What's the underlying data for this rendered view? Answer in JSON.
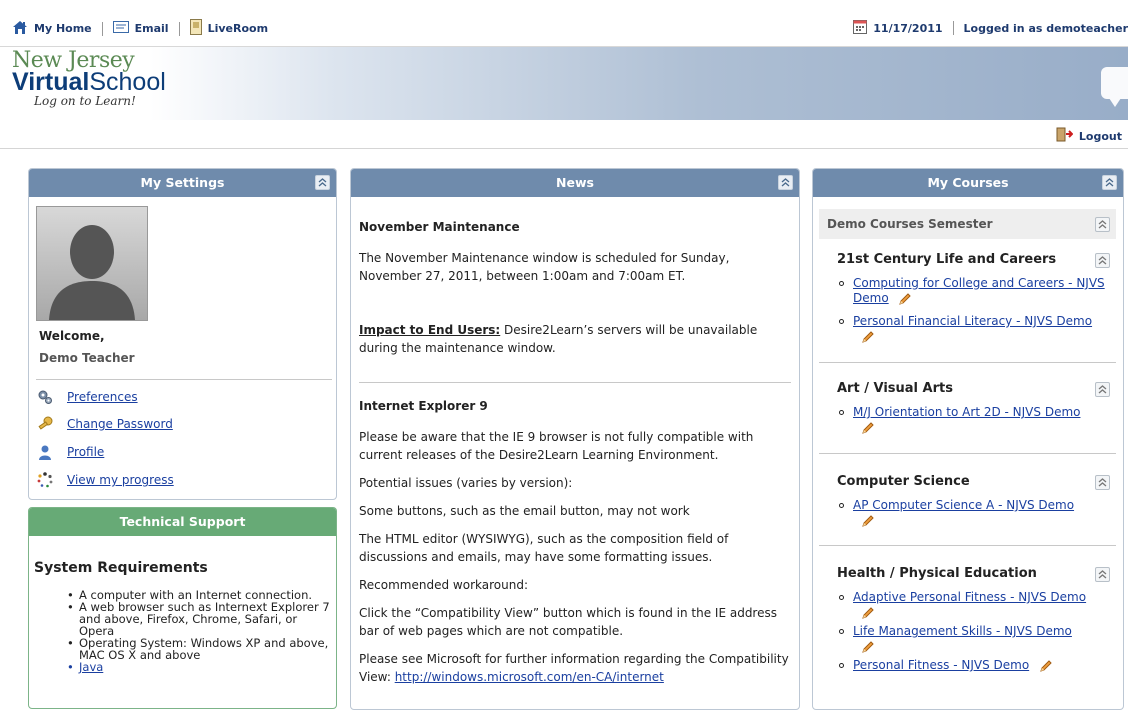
{
  "topnav": {
    "home": "My Home",
    "email": "Email",
    "liveroom": "LiveRoom",
    "date": "11/17/2011",
    "logged_in": "Logged in as demoteacher"
  },
  "logo": {
    "line1": "New Jersey",
    "line2a": "Virtual",
    "line2b": "School",
    "tagline": "Log on to Learn!"
  },
  "logout": "Logout",
  "settings": {
    "title": "My Settings",
    "welcome": "Welcome,",
    "name": "Demo Teacher",
    "links": [
      "Preferences",
      "Change Password",
      "Profile",
      "View my progress"
    ]
  },
  "support": {
    "title": "Technical Support",
    "heading": "System Requirements",
    "items": [
      "A computer with an Internet connection.",
      "A web browser such as Internext Explorer 7 and above, Firefox, Chrome, Safari, or Opera",
      "Operating System: Windows XP and above, MAC OS X and above",
      "Java"
    ]
  },
  "news": {
    "title": "News",
    "items": [
      {
        "title": "November Maintenance",
        "p1": "The November Maintenance window is scheduled for Sunday, November 27, 2011, between 1:00am and 7:00am ET.",
        "impact_label": "Impact to End Users:",
        "impact_text": " Desire2Learn’s servers will be unavailable during the maintenance window."
      },
      {
        "title": "Internet Explorer 9",
        "paras": [
          "Please be aware that the IE 9 browser is not fully compatible with current releases of the Desire2Learn Learning Environment.",
          "Potential issues (varies by version):",
          "Some buttons, such as the email button, may not work",
          "The HTML editor (WYSIWYG), such as the composition field of discussions and emails, may have some formatting issues.",
          "Recommended workaround:",
          "Click the “Compatibility View” button which is found in the IE address bar of web pages which are not compatible."
        ],
        "last_text": "Please see Microsoft for further information regarding the Compatibility View: ",
        "last_link": "http://windows.microsoft.com/en-CA/internet"
      }
    ]
  },
  "courses": {
    "title": "My Courses",
    "semester": "Demo Courses Semester",
    "groups": [
      {
        "title": "21st Century Life and Careers",
        "courses": [
          "Computing for College and Careers - NJVS Demo",
          "Personal Financial Literacy - NJVS Demo"
        ]
      },
      {
        "title": "Art / Visual Arts",
        "courses": [
          "M/J Orientation to Art 2D - NJVS Demo"
        ]
      },
      {
        "title": "Computer Science",
        "courses": [
          "AP Computer Science A - NJVS Demo"
        ]
      },
      {
        "title": "Health / Physical Education",
        "courses": [
          "Adaptive Personal Fitness - NJVS Demo",
          "Life Management Skills - NJVS Demo",
          "Personal Fitness - NJVS Demo"
        ]
      }
    ]
  },
  "colors": {
    "panel_header": "#6f8bac",
    "support_header": "#67aa76",
    "link": "#1a3fa0"
  }
}
